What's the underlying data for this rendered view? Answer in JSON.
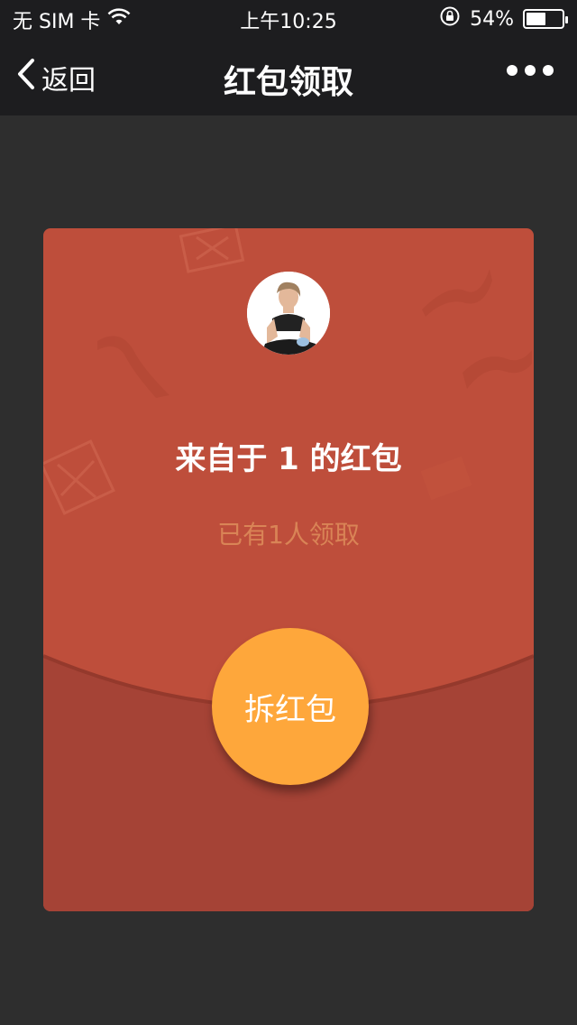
{
  "status_bar": {
    "carrier": "无 SIM 卡",
    "time": "上午10:25",
    "battery_percent_text": "54%",
    "battery_level": 0.54
  },
  "nav": {
    "back_label": "返回",
    "title": "红包领取"
  },
  "card": {
    "from_text": "来自于 1 的红包",
    "claimed_text": "已有1人领取",
    "open_button_label": "拆红包"
  },
  "colors": {
    "background": "#2e2e2e",
    "topbar": "#1d1d1f",
    "card_top": "#be4e3b",
    "card_bottom": "#a54336",
    "button": "#fea73b",
    "claimed_text": "#d98456"
  },
  "icons": {
    "back": "chevron-left-icon",
    "more": "more-dots-icon",
    "wifi": "wifi-icon",
    "lock_rotation": "rotation-lock-icon",
    "battery": "battery-icon"
  }
}
